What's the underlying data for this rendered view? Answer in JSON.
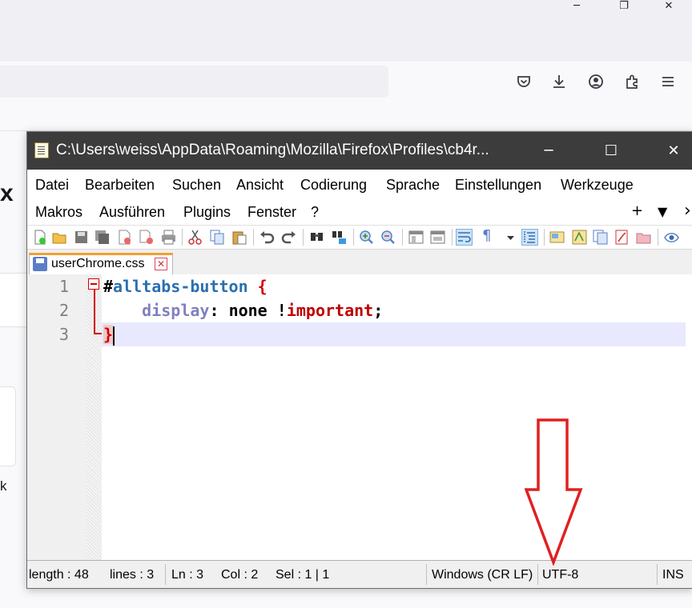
{
  "firefox": {
    "toolbar_icons": [
      "pocket-icon",
      "download-icon",
      "account-icon",
      "extensions-icon",
      "menu-icon"
    ],
    "fragments": [
      "x",
      "k"
    ]
  },
  "npp": {
    "title": "C:\\Users\\weiss\\AppData\\Roaming\\Mozilla\\Firefox\\Profiles\\cb4r...",
    "window_buttons": {
      "minimize": "─",
      "maximize": "☐",
      "close": "✕"
    },
    "menu_row1": [
      "Datei",
      "Bearbeiten",
      "Suchen",
      "Ansicht",
      "Codierung",
      "Sprache",
      "Einstellungen",
      "Werkzeuge"
    ],
    "menu_row2": [
      "Makros",
      "Ausführen",
      "Plugins",
      "Fenster",
      "?"
    ],
    "menu_right": {
      "plus": "+",
      "dropdown": "▼",
      "scroll": "›"
    },
    "tab": {
      "label": "userChrome.css",
      "close": "✕"
    },
    "line_numbers": [
      "1",
      "2",
      "3"
    ],
    "code": {
      "line1_hash": "#",
      "line1_selector": "alltabs-button",
      "line1_brace": " {",
      "line2_indent": "    ",
      "line2_prop": "display",
      "line2_colon": ": ",
      "line2_value": "none ",
      "line2_bang": "!",
      "line2_important": "important",
      "line2_semicolon": ";",
      "line3_brace": "}"
    },
    "status": {
      "length": "length : 48",
      "lines": "lines : 3",
      "ln": "Ln : 3",
      "col": "Col : 2",
      "sel": "Sel : 1 | 1",
      "eol": "Windows (CR LF)",
      "encoding": "UTF-8",
      "mode": "INS"
    },
    "annotation_color": "#e02020"
  }
}
